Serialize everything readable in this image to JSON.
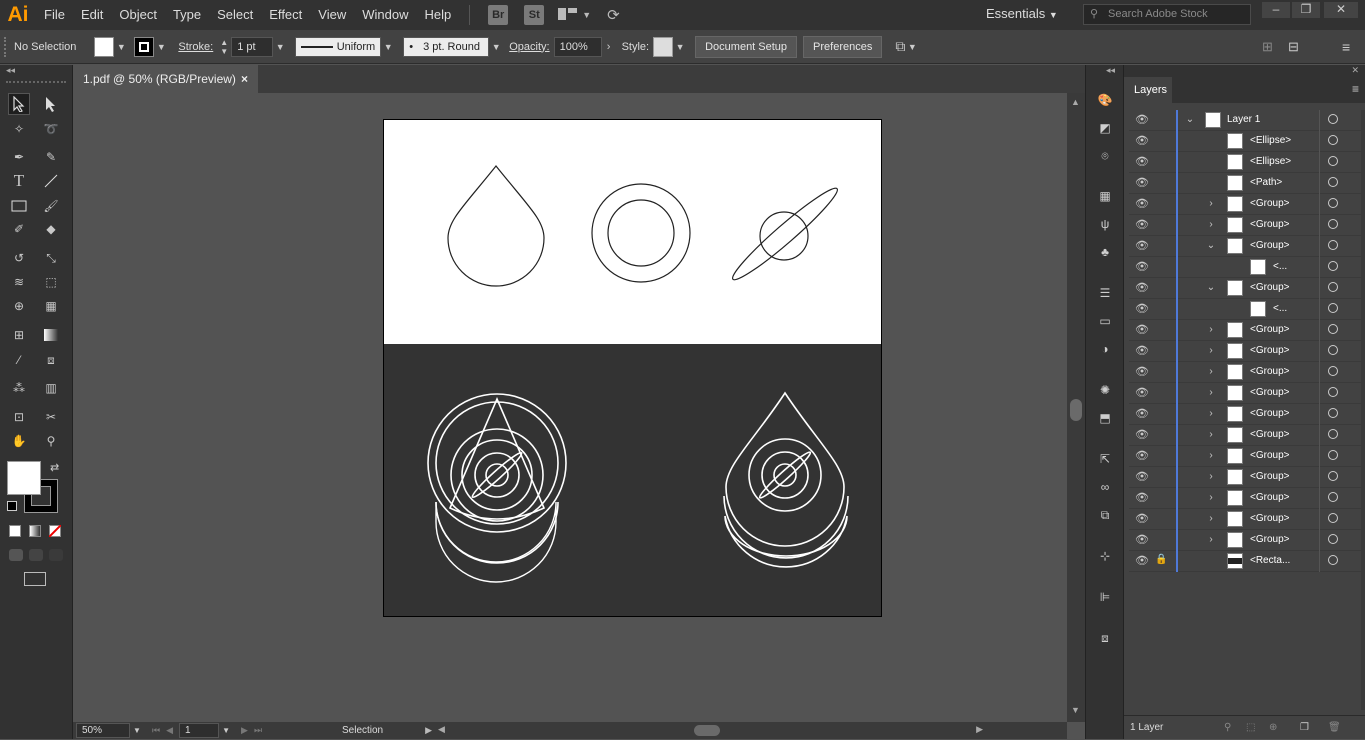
{
  "app": {
    "logo": "Ai"
  },
  "menu": [
    "File",
    "Edit",
    "Object",
    "Type",
    "Select",
    "Effect",
    "View",
    "Window",
    "Help"
  ],
  "bridge_buttons": [
    "Br",
    "St"
  ],
  "workspace": "Essentials",
  "stock_search": {
    "placeholder": "Search Adobe Stock"
  },
  "control_bar": {
    "selection_label": "No Selection",
    "stroke_label": "Stroke:",
    "stroke_weight": "1 pt",
    "stroke_profile": "Uniform",
    "brush": "3 pt. Round",
    "opacity_label": "Opacity:",
    "opacity_value": "100%",
    "style_label": "Style:",
    "document_setup": "Document Setup",
    "preferences": "Preferences"
  },
  "document_tab": {
    "title": "1.pdf @ 50% (RGB/Preview)",
    "close": "×"
  },
  "status_bar": {
    "zoom": "50%",
    "page": "1",
    "tool": "Selection"
  },
  "layers_panel": {
    "title": "Layers",
    "footer": "1 Layer",
    "rows": [
      {
        "name": "Layer 1",
        "indent": 0,
        "chevron": "down"
      },
      {
        "name": "<Ellipse>",
        "indent": 1,
        "chevron": ""
      },
      {
        "name": "<Ellipse>",
        "indent": 1,
        "chevron": ""
      },
      {
        "name": "<Path>",
        "indent": 1,
        "chevron": ""
      },
      {
        "name": "<Group>",
        "indent": 1,
        "chevron": "right"
      },
      {
        "name": "<Group>",
        "indent": 1,
        "chevron": "right"
      },
      {
        "name": "<Group>",
        "indent": 1,
        "chevron": "down"
      },
      {
        "name": "<...",
        "indent": 2,
        "chevron": ""
      },
      {
        "name": "<Group>",
        "indent": 1,
        "chevron": "down"
      },
      {
        "name": "<...",
        "indent": 2,
        "chevron": ""
      },
      {
        "name": "<Group>",
        "indent": 1,
        "chevron": "right"
      },
      {
        "name": "<Group>",
        "indent": 1,
        "chevron": "right"
      },
      {
        "name": "<Group>",
        "indent": 1,
        "chevron": "right"
      },
      {
        "name": "<Group>",
        "indent": 1,
        "chevron": "right"
      },
      {
        "name": "<Group>",
        "indent": 1,
        "chevron": "right"
      },
      {
        "name": "<Group>",
        "indent": 1,
        "chevron": "right"
      },
      {
        "name": "<Group>",
        "indent": 1,
        "chevron": "right"
      },
      {
        "name": "<Group>",
        "indent": 1,
        "chevron": "right"
      },
      {
        "name": "<Group>",
        "indent": 1,
        "chevron": "right"
      },
      {
        "name": "<Group>",
        "indent": 1,
        "chevron": "right"
      },
      {
        "name": "<Group>",
        "indent": 1,
        "chevron": "right"
      },
      {
        "name": "<Recta...",
        "indent": 1,
        "chevron": "",
        "locked": true
      }
    ]
  },
  "colors": {
    "artboard_dark": "#333333",
    "layer_color": "#4f79d8",
    "accent": "#ff9a00"
  }
}
